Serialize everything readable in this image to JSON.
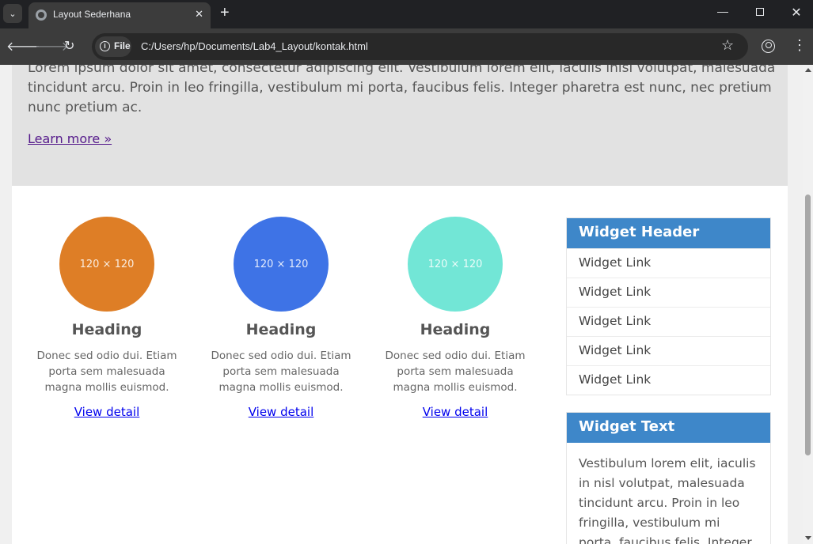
{
  "browser": {
    "tab_title": "Layout Sederhana",
    "close_glyph": "✕",
    "new_tab_glyph": "+",
    "scheme_label": "File",
    "url": "C:/Users/hp/Documents/Lab4_Layout/kontak.html",
    "window_controls": {
      "minimize": "—",
      "close": "✕"
    }
  },
  "hero": {
    "text": "Lorem ipsum dolor sit amet, consectetur adipiscing elit. Vestibulum lorem elit, iaculis inisl volutpat, malesuada tincidunt arcu. Proin in leo fringilla, vestibulum mi porta, faucibus felis. Integer pharetra est nunc, nec pretium nunc pretium ac.",
    "link": "Learn more »"
  },
  "features": [
    {
      "placeholder": "120 × 120",
      "color": "#de7e26",
      "heading": "Heading",
      "text": "Donec sed odio dui. Etiam porta sem malesuada magna mollis euismod.",
      "link": "View detail"
    },
    {
      "placeholder": "120 × 120",
      "color": "#3e73e6",
      "heading": "Heading",
      "text": "Donec sed odio dui. Etiam porta sem malesuada magna mollis euismod.",
      "link": "View detail"
    },
    {
      "placeholder": "120 × 120",
      "color": "#72e6d6",
      "heading": "Heading",
      "text": "Donec sed odio dui. Etiam porta sem malesuada magna mollis euismod.",
      "link": "View detail"
    }
  ],
  "widget_links": {
    "header": "Widget Header",
    "links": [
      "Widget Link",
      "Widget Link",
      "Widget Link",
      "Widget Link",
      "Widget Link"
    ]
  },
  "widget_text": {
    "header": "Widget Text",
    "body": "Vestibulum lorem elit, iaculis in nisl volutpat, malesuada tincidunt arcu. Proin in leo fringilla, vestibulum mi porta, faucibus felis. Integer"
  },
  "colors": {
    "widget_header_bg": "#3e87c9",
    "link_visited": "#551a8b",
    "link": "#0000ee"
  }
}
